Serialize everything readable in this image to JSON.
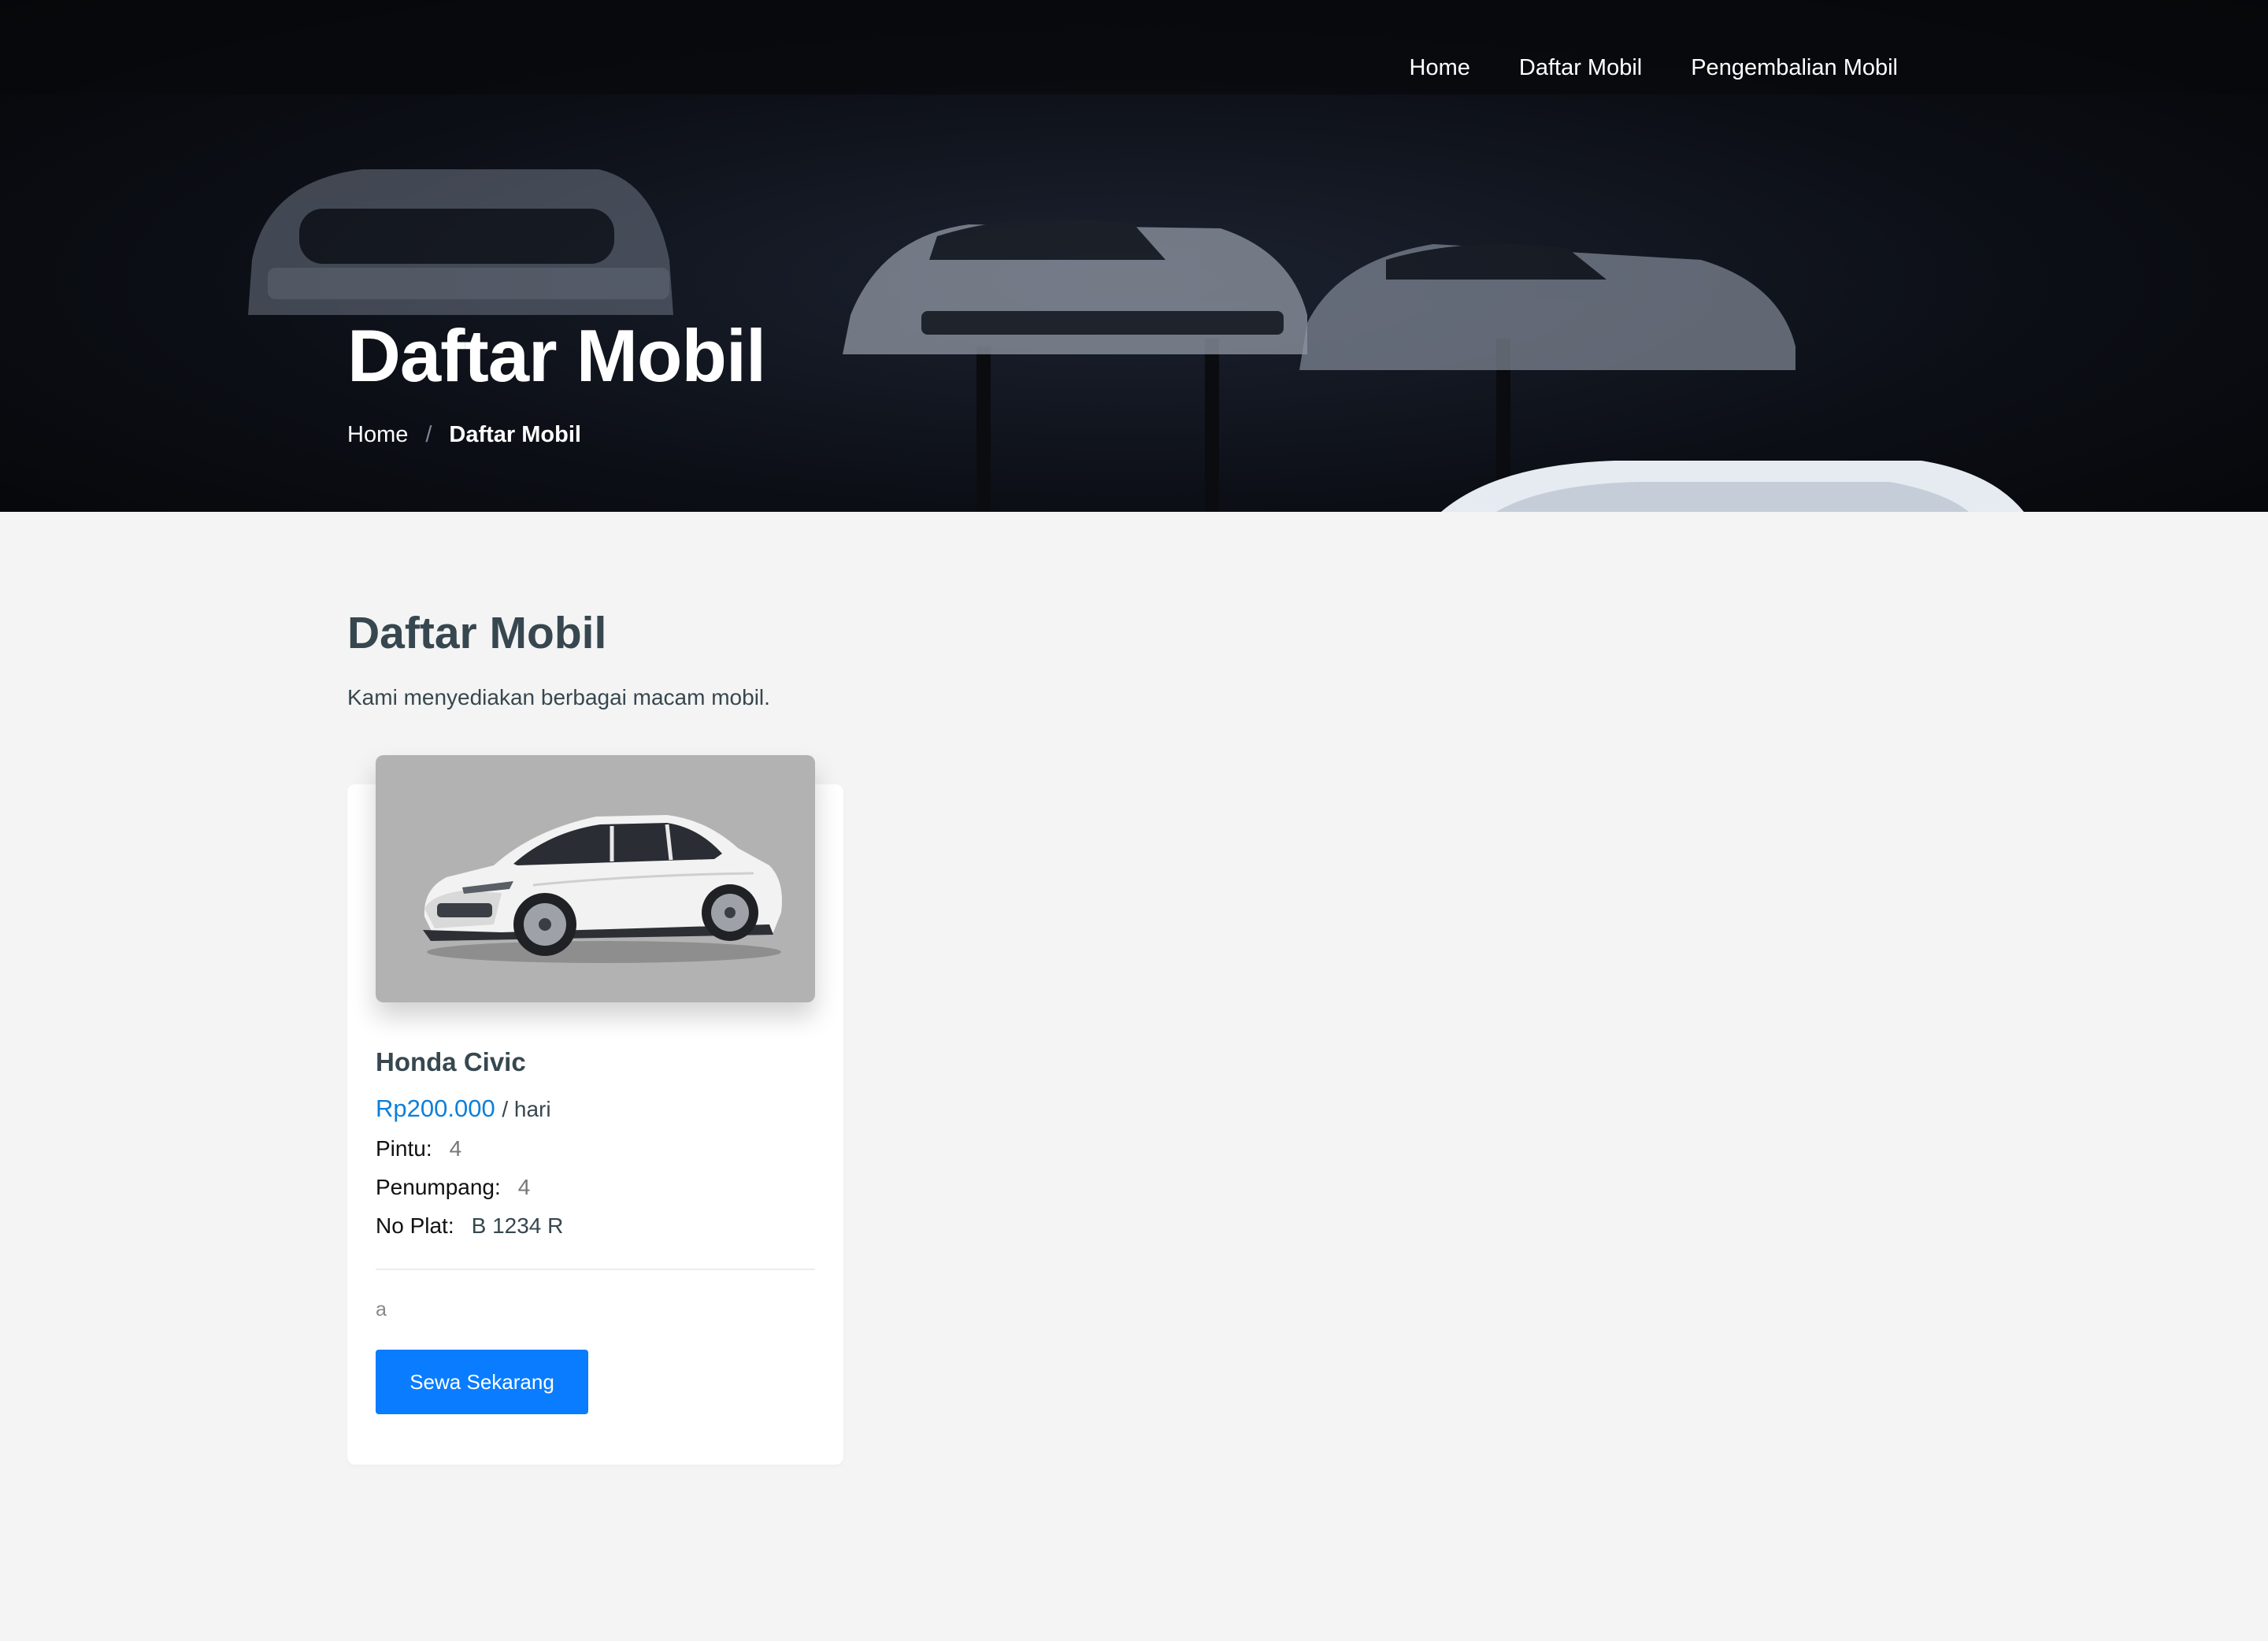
{
  "nav": {
    "items": [
      {
        "label": "Home"
      },
      {
        "label": "Daftar Mobil"
      },
      {
        "label": "Pengembalian Mobil"
      }
    ]
  },
  "hero": {
    "title": "Daftar Mobil",
    "breadcrumb": {
      "home": "Home",
      "separator": "/",
      "current": "Daftar Mobil"
    }
  },
  "section": {
    "title": "Daftar Mobil",
    "subtitle": "Kami menyediakan berbagai macam mobil."
  },
  "cars": [
    {
      "name": "Honda Civic",
      "price": "Rp200.000",
      "price_unit": "/ hari",
      "doors_label": "Pintu:",
      "doors": "4",
      "passengers_label": "Penumpang:",
      "passengers": "4",
      "plate_label": "No Plat:",
      "plate": "B 1234 R",
      "description": "a",
      "button_label": "Sewa Sekarang"
    }
  ],
  "colors": {
    "price": "#0d7fd8",
    "button": "#0a7cff",
    "heading": "#37474f",
    "page_bg": "#f4f4f4"
  }
}
